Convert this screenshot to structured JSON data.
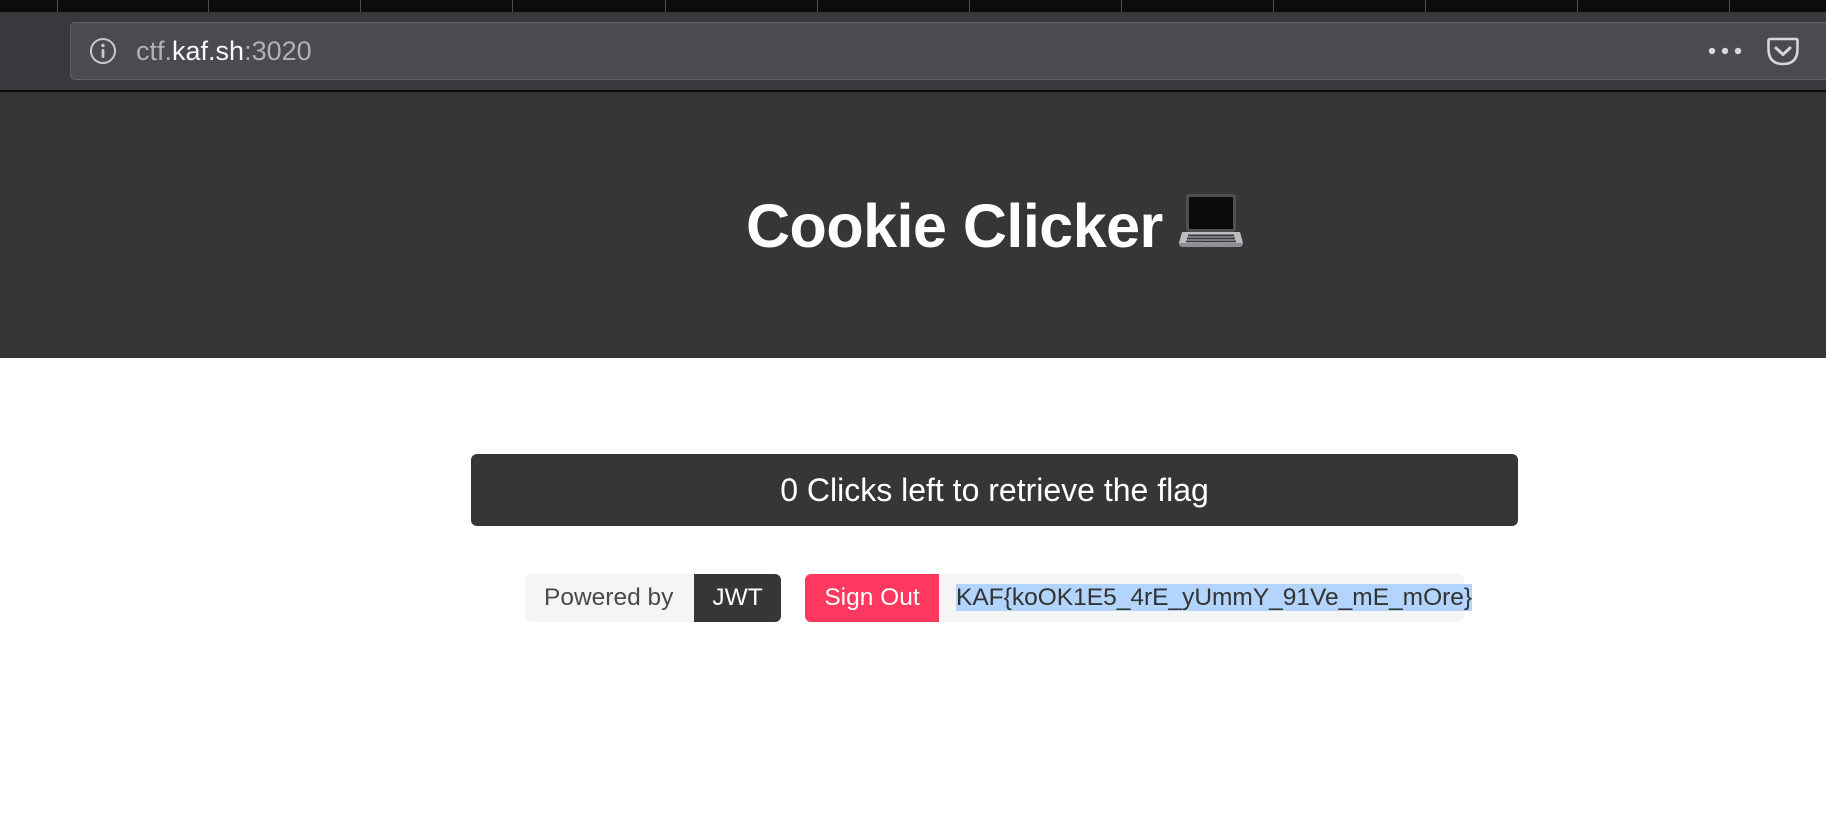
{
  "browser": {
    "url": {
      "prefix": "ctf.",
      "host": "kaf.sh",
      "port": ":3020"
    },
    "icons": {
      "site_info": "info-icon",
      "page_actions": "more-icon",
      "pocket": "pocket-icon"
    }
  },
  "header": {
    "title": "Cookie Clicker",
    "title_emoji": "laptop-icon"
  },
  "main": {
    "clicks_button_label": "0 Clicks left to retrieve the flag",
    "powered_by": {
      "label": "Powered by",
      "value": "JWT"
    },
    "sign_out_label": "Sign Out",
    "flag": "KAF{koOK1E5_4rE_yUmmY_91Ve_mE_mOre}"
  },
  "colors": {
    "header_bg": "#363636",
    "sign_out_bg": "#ff3860",
    "tag_bg": "#f5f5f5",
    "selection_bg": "#b3d4fc"
  }
}
